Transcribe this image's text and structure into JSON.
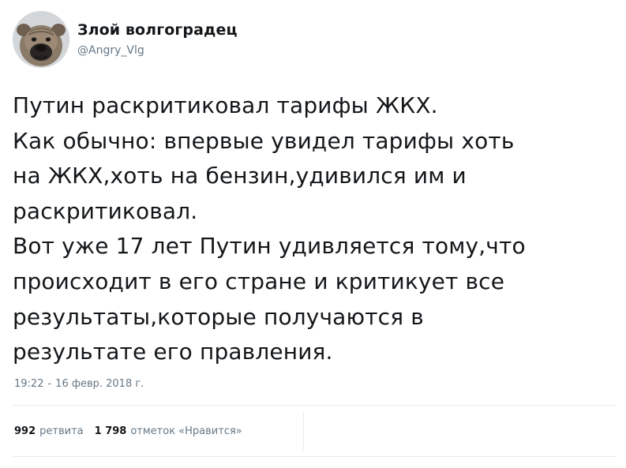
{
  "author": {
    "display_name": "Злой волгоградец",
    "username": "@Angry_Vlg",
    "avatar_icon": "dog-avatar-icon"
  },
  "tweet": {
    "lines": [
      "Путин раскритиковал тарифы ЖКХ.",
      "Как обычно: впервые увидел тарифы хоть",
      "на ЖКХ,хоть на бензин,удивился им и",
      "раскритиковал.",
      "Вот уже 17 лет Путин удивляется тому,что",
      "происходит в его стране и критикует все",
      "результаты,которые получаются в",
      "результате его правления."
    ],
    "time": "19:22",
    "separator": "-",
    "date": "16 февр. 2018 г."
  },
  "stats": {
    "retweets_count": "992",
    "retweets_label": "ретвита",
    "likes_count": "1 798",
    "likes_label": "отметок «Нравится»"
  },
  "colors": {
    "text": "#14171a",
    "secondary": "#657786",
    "divider": "#e6ecf0"
  }
}
